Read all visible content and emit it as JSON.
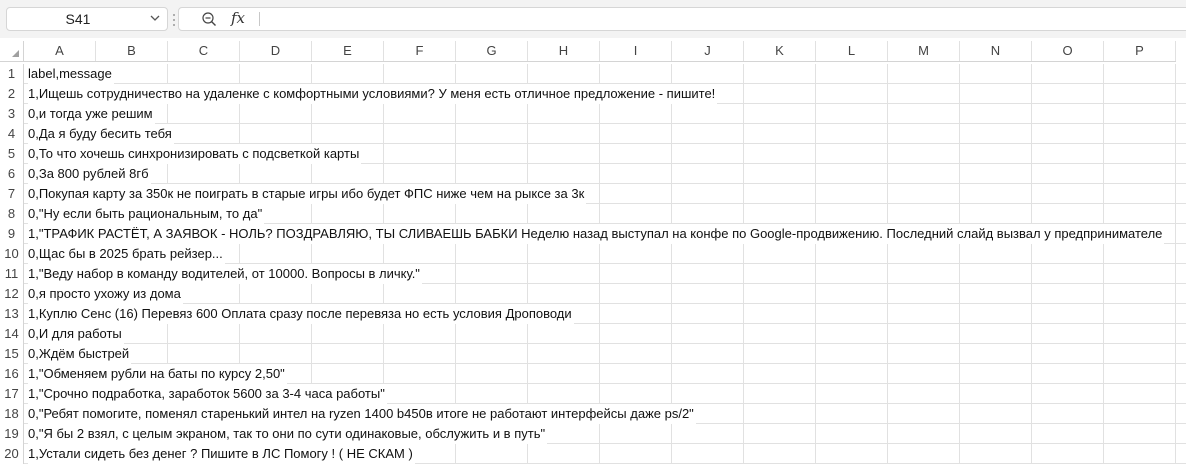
{
  "name_box": {
    "value": "S41"
  },
  "formula_bar": {
    "fx_label": "fx",
    "value": ""
  },
  "columns": [
    "A",
    "B",
    "C",
    "D",
    "E",
    "F",
    "G",
    "H",
    "I",
    "J",
    "K",
    "L",
    "M",
    "N",
    "O",
    "P"
  ],
  "rows": [
    {
      "num": "1",
      "a": "label,message"
    },
    {
      "num": "2",
      "a": "1,Ищешь сотрудничество на удаленке с комфортными условиями? У меня есть отличное предложение - пишите!"
    },
    {
      "num": "3",
      "a": "0,и тогда уже решим"
    },
    {
      "num": "4",
      "a": "0,Да я буду бесить тебя"
    },
    {
      "num": "5",
      "a": "0,То что хочешь синхронизировать с подсветкой карты"
    },
    {
      "num": "6",
      "a": "0,За 800 рублей 8гб"
    },
    {
      "num": "7",
      "a": "0,Покупая карту за 350к не поиграть в старые игры ибо будет ФПС ниже чем на рыксе за 3к"
    },
    {
      "num": "8",
      "a": "0,\"Ну если быть рациональным, то да\""
    },
    {
      "num": "9",
      "a": "1,\"ТРАФИК РАСТЁТ, А ЗАЯВОК - НОЛЬ? ПОЗДРАВЛЯЮ, ТЫ СЛИВАЕШЬ БАБКИ Неделю назад выступал на конфе по Google-продвижению. Последний слайд вызвал у предпринимателе"
    },
    {
      "num": "10",
      "a": "0,Щас бы в 2025 брать рейзер..."
    },
    {
      "num": "11",
      "a": "1,\"Веду набор в команду водителей, от 10000. Вопросы в личку.\""
    },
    {
      "num": "12",
      "a": "0,я просто ухожу из дома"
    },
    {
      "num": "13",
      "a": "1,Куплю Сенс (16) Перевяз 600 Оплата сразу после перевяза но есть условия Дроповоди"
    },
    {
      "num": "14",
      "a": "0,И для работы"
    },
    {
      "num": "15",
      "a": "0,Ждём быстрей"
    },
    {
      "num": "16",
      "a": "1,\"Обменяем рубли на баты по курсу 2,50\""
    },
    {
      "num": "17",
      "a": "1,\"Срочно подработка, заработок 5600 за 3-4 часа работы\""
    },
    {
      "num": "18",
      "a": "0,\"Ребят помогите, поменял старенький интел на ryzen 1400 b450в итоге не работают интерфейсы даже ps/2\""
    },
    {
      "num": "19",
      "a": "0,\"Я бы 2 взял, с целым экраном, так то они по сути одинаковые, обслужить и в путь\""
    },
    {
      "num": "20",
      "a": "1,Устали сидеть без денег ? Пишите в ЛС Помогу ! ( НЕ СКАМ )"
    }
  ]
}
